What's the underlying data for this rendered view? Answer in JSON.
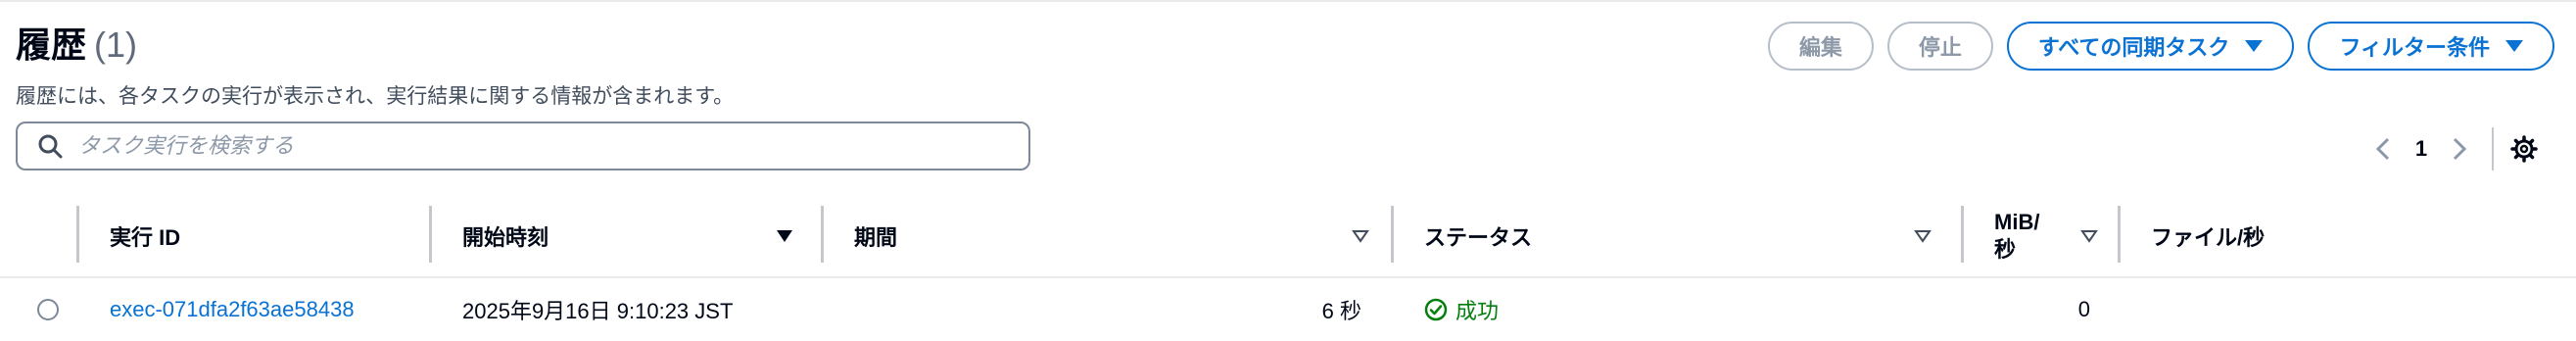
{
  "header": {
    "title": "履歴",
    "count": "(1)",
    "description": "履歴には、各タスクの実行が表示され、実行結果に関する情報が含まれます。"
  },
  "actions": {
    "edit_label": "編集",
    "stop_label": "停止",
    "all_sync_tasks_label": "すべての同期タスク",
    "filter_label": "フィルター条件"
  },
  "search": {
    "placeholder": "タスク実行を検索する",
    "value": ""
  },
  "pagination": {
    "current_page": "1"
  },
  "table": {
    "columns": [
      {
        "label": "実行 ID"
      },
      {
        "label": "開始時刻"
      },
      {
        "label": "期間"
      },
      {
        "label": "ステータス"
      },
      {
        "label": "MiB/秒"
      },
      {
        "label": "ファイル/秒"
      }
    ],
    "rows": [
      {
        "execution_id": "exec-071dfa2f63ae58438",
        "start_time": "2025年9月16日 9:10:23 JST",
        "duration": "6 秒",
        "status": "成功",
        "mib_per_sec": "0",
        "files_per_sec": ""
      }
    ]
  },
  "colors": {
    "primary": "#0972d3",
    "success": "#037f0c",
    "disabled": "#8d99a8"
  },
  "icons": [
    "search-icon",
    "chevron-left-icon",
    "chevron-right-icon",
    "settings-icon",
    "sort-desc-icon",
    "sort-icon",
    "success-check-icon",
    "caret-down-icon"
  ]
}
